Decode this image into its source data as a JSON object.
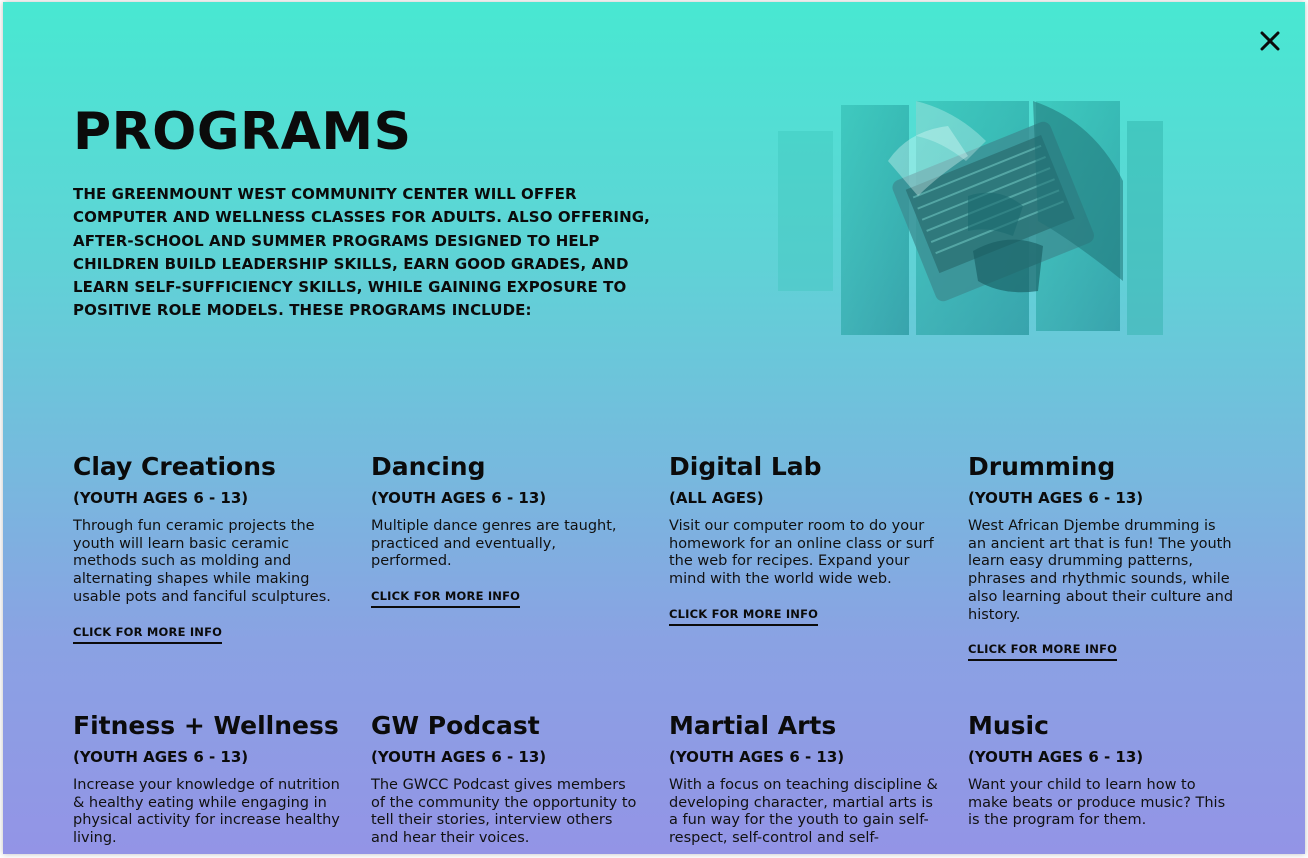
{
  "modal": {
    "close_label": "×",
    "title": "PROGRAMS",
    "intro": "THE GREENMOUNT WEST COMMUNITY CENTER WILL OFFER COMPUTER AND WELLNESS CLASSES FOR ADULTS. ALSO OFFERING, AFTER-SCHOOL AND SUMMER PROGRAMS DESIGNED TO HELP CHILDREN BUILD LEADERSHIP SKILLS, EARN GOOD GRADES, AND LEARN SELF-SUFFICIENCY SKILLS, WHILE GAINING EXPOSURE TO POSITIVE ROLE MODELS. THESE PROGRAMS INCLUDE:"
  },
  "programs": [
    {
      "name": "Clay Creations",
      "ages": "(YOUTH AGES 6 - 13)",
      "description": "Through fun ceramic projects the youth will learn basic ceramic methods such as molding and alternating shapes while making usable pots and fanciful sculptures.",
      "link": "CLICK FOR MORE INFO"
    },
    {
      "name": "Dancing",
      "ages": "(YOUTH AGES 6 - 13)",
      "description": "Multiple dance genres are taught, practiced and eventually, performed.",
      "link": "CLICK FOR MORE INFO"
    },
    {
      "name": "Digital Lab",
      "ages": "(ALL AGES)",
      "description": "Visit our computer room to do your homework for an online class or surf the web for recipes. Expand your mind with the world wide web.",
      "link": "CLICK FOR MORE INFO"
    },
    {
      "name": "Drumming",
      "ages": "(YOUTH AGES 6 - 13)",
      "description": "West African Djembe drumming is an ancient art that is fun! The youth learn easy drumming patterns, phrases and rhythmic sounds, while also learning about their culture and history.",
      "link": "CLICK FOR MORE INFO"
    },
    {
      "name": "Fitness + Wellness",
      "ages": "(YOUTH AGES 6 - 13)",
      "description": "Increase your knowledge of nutrition & healthy eating while engaging in physical activity for increase healthy living."
    },
    {
      "name": "GW Podcast",
      "ages": "(YOUTH AGES 6 - 13)",
      "description": "The GWCC Podcast gives members of the community the opportunity to tell their stories, interview others and hear their voices."
    },
    {
      "name": "Martial Arts",
      "ages": "(YOUTH AGES 6 - 13)",
      "description": "With a focus on teaching discipline & developing character, martial arts is a fun way for the youth to gain self-respect, self-control and self-"
    },
    {
      "name": "Music",
      "ages": "(YOUTH AGES 6 - 13)",
      "description": "Want your child to learn how to make beats or produce music? This is the program for them."
    }
  ]
}
